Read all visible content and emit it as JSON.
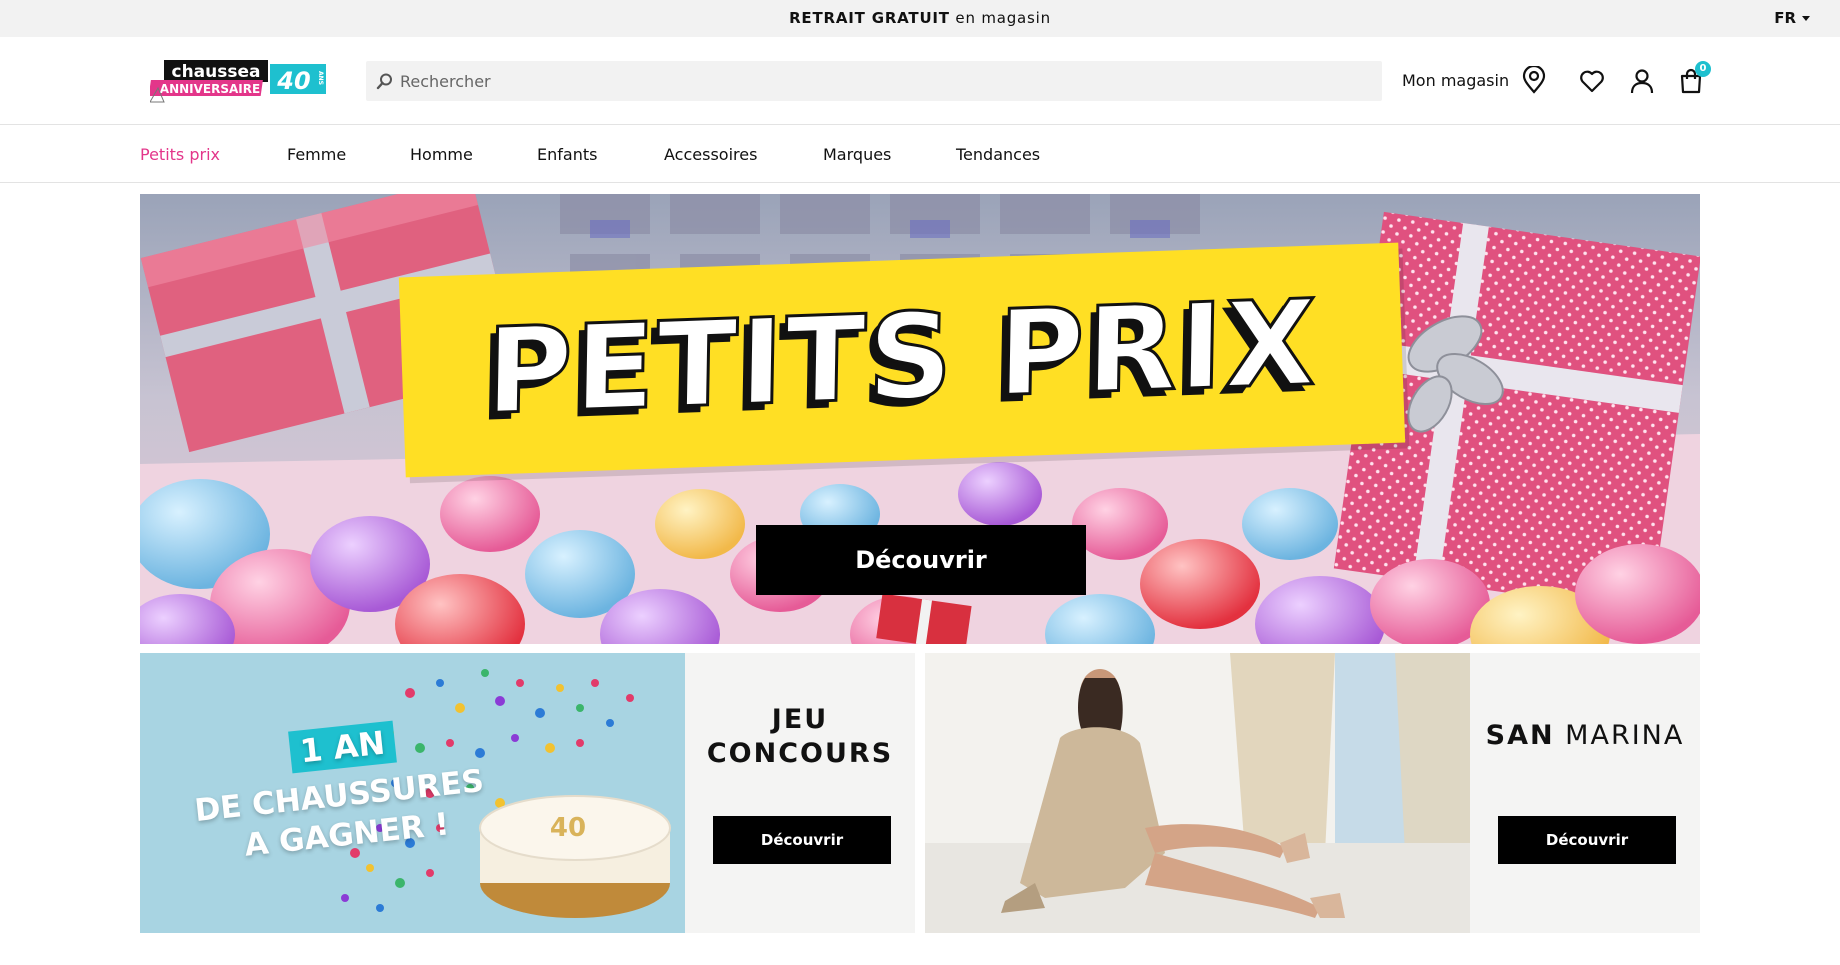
{
  "topbar": {
    "promo_bold": "RETRAIT GRATUIT",
    "promo_rest": " en magasin",
    "language": "FR"
  },
  "header": {
    "logo_text": "chaussea",
    "logo_sub": "ANNIVERSAIRE",
    "logo_years": "40",
    "logo_ans": "ANS",
    "search_placeholder": "Rechercher",
    "store_label": "Mon magasin",
    "cart_count": "0"
  },
  "nav": {
    "items": [
      {
        "label": "Petits prix",
        "active": true
      },
      {
        "label": "Femme"
      },
      {
        "label": "Homme"
      },
      {
        "label": "Enfants"
      },
      {
        "label": "Accessoires"
      },
      {
        "label": "Marques"
      },
      {
        "label": "Tendances"
      }
    ]
  },
  "hero": {
    "title": "PETITS PRIX",
    "button": "Découvrir"
  },
  "cards": [
    {
      "overlay_badge": "1 AN",
      "overlay_line1": "DE CHAUSSURES",
      "overlay_line2": "A GAGNER !",
      "cake_number": "40",
      "title_line1": "JEU",
      "title_line2": "CONCOURS",
      "button": "Découvrir"
    },
    {
      "title_bold": "SAN",
      "title_light": " MARINA",
      "button": "Découvrir"
    }
  ],
  "colors": {
    "accent_pink": "#e3368a",
    "accent_teal": "#1ec0cf",
    "hero_yellow": "#ffdf24"
  }
}
